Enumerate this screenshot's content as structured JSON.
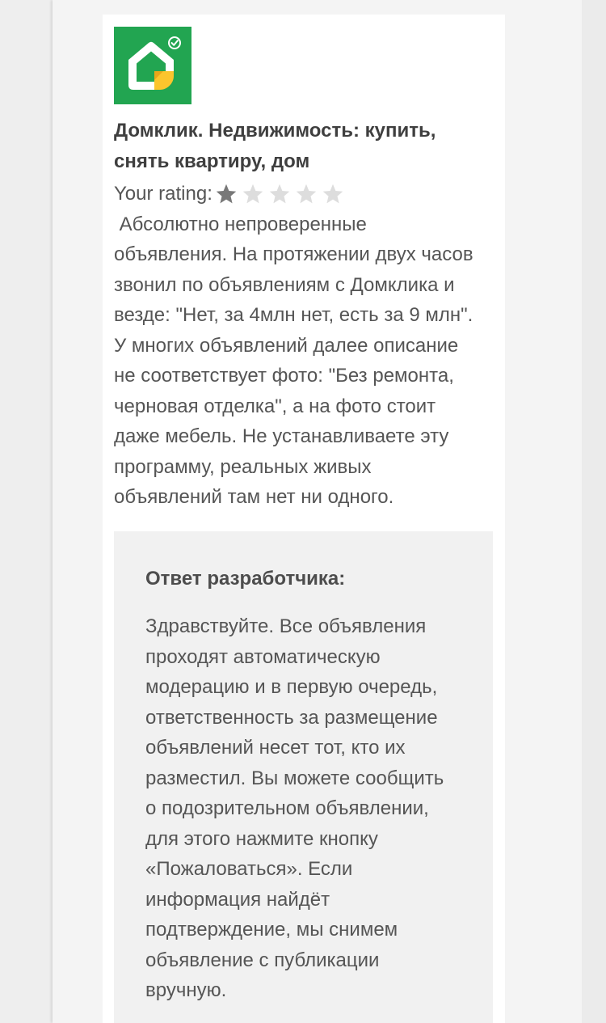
{
  "app": {
    "icon": "domclick-house-icon",
    "title_lines": [
      "Домклик. Недвижимость: купить,",
      "снять квартиру, дом"
    ]
  },
  "rating": {
    "label": "Your rating:",
    "value": 1,
    "max": 5,
    "star_icon": "star-icon"
  },
  "review": {
    "lines": [
      " Абсолютно непроверенные",
      "объявления. На протяжении двух часов",
      "звонил по объявлениям с Домклика и",
      "везде: \"Нет, за 4млн нет, есть за 9 млн\".",
      "У многих объявлений далее описание",
      "не соответствует фото: \"Без ремонта,",
      "черновая отделка\", а на фото стоит",
      "даже мебель. Не устанавливаете эту",
      "программу, реальных живых",
      "объявлений там нет ни одного."
    ]
  },
  "developer_response": {
    "heading": "Ответ разработчика:",
    "lines": [
      "Здравствуйте. Все объявления",
      "проходят автоматическую",
      "модерацию и в первую очередь,",
      "ответственность за размещение",
      "объявлений несет тот, кто их",
      "разместил. Вы можете сообщить",
      "о подозрительном объявлении,",
      "для этого нажмите кнопку",
      "«Пожаловаться». Если",
      "информация найдёт",
      "подтверждение, мы снимем",
      "объявление с публикации",
      "вручную."
    ]
  },
  "colors": {
    "icon_background": "#22a551",
    "icon_fold": "#fbc52d",
    "star_filled": "#787878",
    "star_empty": "#dddddd",
    "response_background": "#f1f1f1"
  }
}
